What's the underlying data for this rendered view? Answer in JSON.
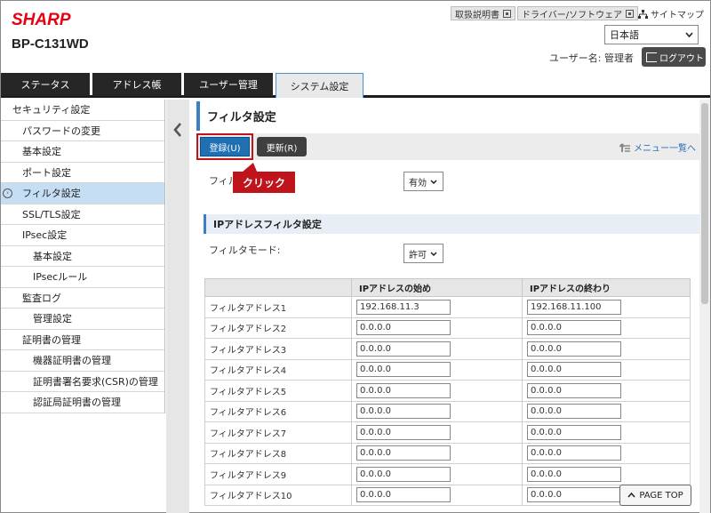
{
  "header": {
    "logo": "SHARP",
    "model": "BP-C131WD",
    "manual_label": "取扱説明書",
    "driver_label": "ドライバー/ソフトウェア",
    "sitemap_label": "サイトマップ",
    "language": "日本語",
    "user_label": "ユーザー名: 管理者",
    "logout_label": "ログアウト"
  },
  "tabs": [
    {
      "label": "ステータス"
    },
    {
      "label": "アドレス帳"
    },
    {
      "label": "ユーザー管理"
    },
    {
      "label": "システム設定"
    }
  ],
  "sidebar": {
    "items": [
      {
        "label": "セキュリティ設定"
      },
      {
        "label": "パスワードの変更"
      },
      {
        "label": "基本設定"
      },
      {
        "label": "ポート設定"
      },
      {
        "label": "フィルタ設定"
      },
      {
        "label": "SSL/TLS設定"
      },
      {
        "label": "IPsec設定"
      },
      {
        "label": "基本設定"
      },
      {
        "label": "IPsecルール"
      },
      {
        "label": "監査ログ"
      },
      {
        "label": "管理設定"
      },
      {
        "label": "証明書の管理"
      },
      {
        "label": "機器証明書の管理"
      },
      {
        "label": "証明書署名要求(CSR)の管理"
      },
      {
        "label": "認証局証明書の管理"
      }
    ]
  },
  "main": {
    "page_title": "フィルタ設定",
    "register_label": "登録(U)",
    "update_label": "更新(R)",
    "menu_link": "メニュー一覧へ",
    "callout": "クリック",
    "filter_label": "フィル",
    "filter_value": "有効",
    "section_title": "IPアドレスフィルタ設定",
    "mode_label": "フィルタモード:",
    "mode_value": "許可",
    "table": {
      "headers": [
        "",
        "IPアドレスの始め",
        "IPアドレスの終わり"
      ],
      "rows": [
        {
          "name": "フィルタアドレス1",
          "start": "192.168.11.3",
          "end": "192.168.11.100"
        },
        {
          "name": "フィルタアドレス2",
          "start": "0.0.0.0",
          "end": "0.0.0.0"
        },
        {
          "name": "フィルタアドレス3",
          "start": "0.0.0.0",
          "end": "0.0.0.0"
        },
        {
          "name": "フィルタアドレス4",
          "start": "0.0.0.0",
          "end": "0.0.0.0"
        },
        {
          "name": "フィルタアドレス5",
          "start": "0.0.0.0",
          "end": "0.0.0.0"
        },
        {
          "name": "フィルタアドレス6",
          "start": "0.0.0.0",
          "end": "0.0.0.0"
        },
        {
          "name": "フィルタアドレス7",
          "start": "0.0.0.0",
          "end": "0.0.0.0"
        },
        {
          "name": "フィルタアドレス8",
          "start": "0.0.0.0",
          "end": "0.0.0.0"
        },
        {
          "name": "フィルタアドレス9",
          "start": "0.0.0.0",
          "end": "0.0.0.0"
        },
        {
          "name": "フィルタアドレス10",
          "start": "0.0.0.0",
          "end": "0.0.0.0"
        }
      ]
    },
    "page_top_label": "PAGE TOP"
  },
  "colors": {
    "brand": "#e50012",
    "accent": "#1f6fb3",
    "callout": "#c0141c",
    "active_sidebar": "#c5def4"
  }
}
